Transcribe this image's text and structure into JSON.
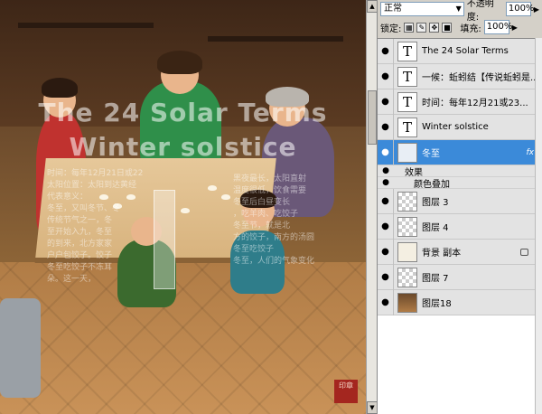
{
  "canvas": {
    "overlay_title_1": "The 24 Solar Terms",
    "overlay_title_2": "Winter solstice",
    "overlay_lines_left": [
      "时间：每年12月21日或22",
      "太阳位置：太阳到达黄经",
      "代表意义：",
      "冬至，又叫冬节、冬",
      "传统节气之一，冬",
      "至开始入九，冬至",
      "的到来，北方家家",
      "户户包饺子。饺子",
      "冬至吃饺子不冻耳",
      "朵。这一天，"
    ],
    "overlay_lines_right": [
      "黑夜最长，太阳直射",
      "温度很低，饮食需要",
      "冬至后白昼变长",
      "，吃羊肉、吃饺子",
      "冬至节，就是北",
      "方的饺子，南方的汤圆",
      "冬至吃饺子",
      "冬至，人们的气象变化"
    ],
    "stamp_text": "印章"
  },
  "panel": {
    "blend_mode": "正常",
    "opacity_label": "不透明度:",
    "opacity_value": "100%",
    "lock_label": "锁定:",
    "fill_label": "填充:",
    "fill_value": "100%"
  },
  "layers": [
    {
      "name": "The 24 Solar Terms",
      "type": "text",
      "thumb": "T"
    },
    {
      "name": "一候：蚯蚓结【传说蚯蚓是...",
      "type": "text",
      "thumb": "T"
    },
    {
      "name": "时间：每年12月21或23...",
      "type": "text",
      "thumb": "T"
    },
    {
      "name": "Winter solstice",
      "type": "text",
      "thumb": "T"
    },
    {
      "name": "冬至",
      "type": "image",
      "fx": "fx",
      "effects_label": "效果",
      "effect_item": "颜色叠加"
    },
    {
      "name": "图层 3",
      "type": "image"
    },
    {
      "name": "图层 4",
      "type": "image"
    },
    {
      "name": "背景 副本",
      "type": "image"
    },
    {
      "name": "图层 7",
      "type": "image"
    },
    {
      "name": "图层18",
      "type": "image"
    }
  ]
}
